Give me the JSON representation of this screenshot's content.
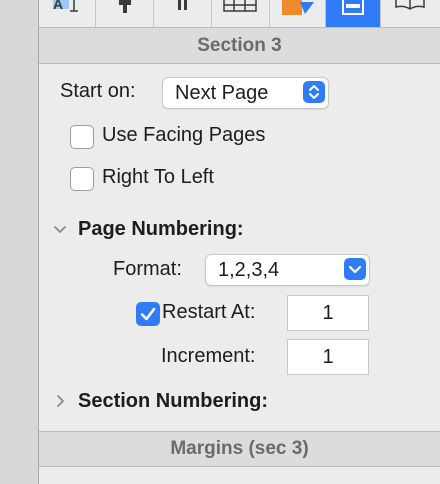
{
  "toolbar": {
    "tabs": [
      {
        "icon": "text-format-icon"
      },
      {
        "icon": "paragraph-icon"
      },
      {
        "icon": "columns-icon"
      },
      {
        "icon": "table-icon"
      },
      {
        "icon": "shape-icon"
      },
      {
        "icon": "layout-icon",
        "active": true
      },
      {
        "icon": "book-icon"
      }
    ]
  },
  "section": {
    "title": "Section 3",
    "start_on_label": "Start on:",
    "start_on_value": "Next Page",
    "use_facing_pages_label": "Use Facing Pages",
    "use_facing_pages_checked": false,
    "right_to_left_label": "Right To Left",
    "right_to_left_checked": false
  },
  "page_numbering": {
    "title": "Page Numbering:",
    "expanded": true,
    "format_label": "Format:",
    "format_value": "1,2,3,4",
    "restart_label": "Restart At:",
    "restart_checked": true,
    "restart_value": "1",
    "increment_label": "Increment:",
    "increment_value": "1"
  },
  "section_numbering": {
    "title": "Section Numbering:",
    "expanded": false
  },
  "margins": {
    "title": "Margins (sec 3)"
  },
  "colors": {
    "accent": "#2f7cf6",
    "panel_bg": "#ececec",
    "header_bg": "#dcdcdc",
    "header_text": "#6b6b6b"
  }
}
